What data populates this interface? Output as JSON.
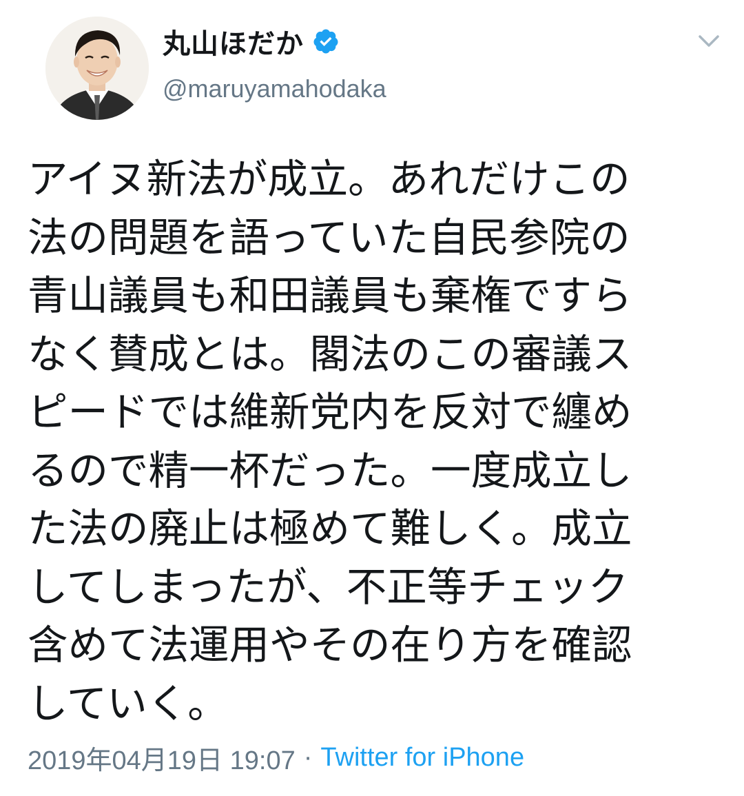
{
  "tweet": {
    "display_name": "丸山ほだか",
    "handle": "@maruyamahodaka",
    "verified": true,
    "body": "アイヌ新法が成立。あれだけこの\n法の問題を語っていた自民参院の\n青山議員も和田議員も棄権ですら\nなく賛成とは。閣法のこの審議ス\nピードでは維新党内を反対で纏め\nるので精一杯だった。一度成立し\nた法の廃止は極めて難しく。成立\nしてしまったが、不正等チェック\n含めて法運用やその在り方を確認\nしていく。",
    "timestamp": "2019年04月19日 19:07",
    "separator": "·",
    "source": "Twitter for iPhone"
  },
  "icons": {
    "verified": "verified-badge-icon",
    "menu": "chevron-down-icon",
    "avatar": "profile-photo"
  },
  "colors": {
    "text": "#14171a",
    "secondary": "#657786",
    "link": "#1da1f2",
    "verified": "#1da1f2"
  }
}
